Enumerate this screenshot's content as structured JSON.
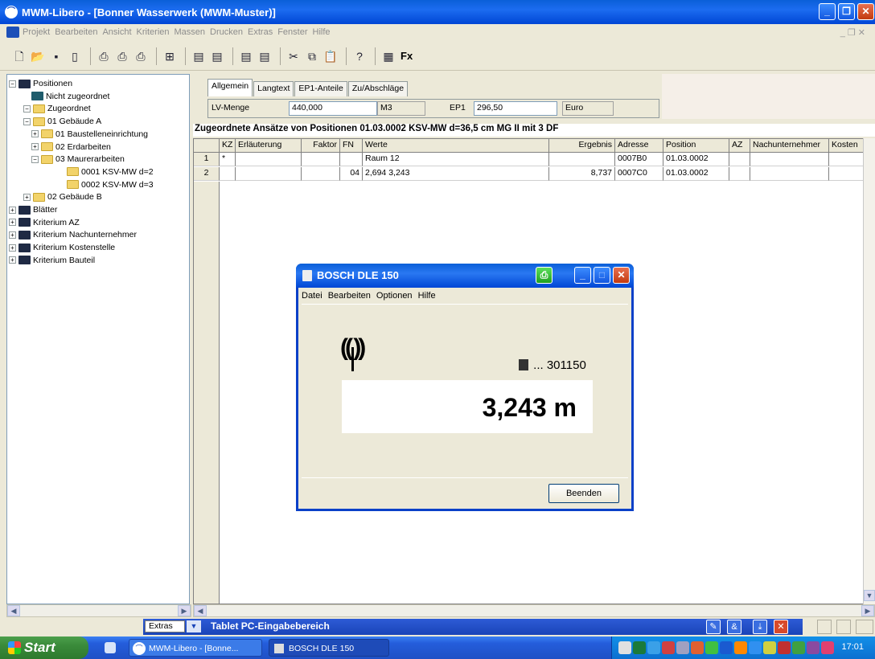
{
  "window": {
    "title": "MWM-Libero - [Bonner Wasserwerk (MWM-Muster)]"
  },
  "menu": [
    "Projekt",
    "Bearbeiten",
    "Ansicht",
    "Kriterien",
    "Massen",
    "Drucken",
    "Extras",
    "Fenster",
    "Hilfe"
  ],
  "toolbar": {
    "icons": [
      "new-icon",
      "open-icon",
      "save-icon",
      "properties-icon",
      "print-icon",
      "print-preview-icon",
      "print-setup-icon",
      "table-icon",
      "import-icon",
      "export-icon",
      "measure-in-icon",
      "measure-out-icon",
      "cut-icon",
      "copy-icon",
      "paste-icon",
      "help-icon",
      "calculator-icon"
    ],
    "fx_label": "Fx"
  },
  "tree": {
    "nodes": [
      {
        "label": "Positionen",
        "level": 0,
        "toggle": "−",
        "folder": "dark"
      },
      {
        "label": "Nicht zugeordnet",
        "level": 1,
        "toggle": "",
        "folder": "teal"
      },
      {
        "label": "Zugeordnet",
        "level": 1,
        "toggle": "−",
        "folder": "y"
      },
      {
        "label": "01 Gebäude A",
        "level": 2,
        "toggle": "−",
        "folder": "y"
      },
      {
        "label": "01 Baustelleneinrichtung",
        "level": 3,
        "toggle": "+",
        "folder": "y"
      },
      {
        "label": "02 Erdarbeiten",
        "level": 3,
        "toggle": "+",
        "folder": "y"
      },
      {
        "label": "03 Maurerarbeiten",
        "level": 3,
        "toggle": "−",
        "folder": "y"
      },
      {
        "label": "0001  KSV-MW d=2",
        "level": 4,
        "toggle": "",
        "folder": "y"
      },
      {
        "label": "0002  KSV-MW d=3",
        "level": 4,
        "toggle": "",
        "folder": "y"
      },
      {
        "label": "02 Gebäude B",
        "level": 2,
        "toggle": "+",
        "folder": "y"
      },
      {
        "label": "Blätter",
        "level": 0,
        "toggle": "+",
        "folder": "dark"
      },
      {
        "label": "Kriterium AZ",
        "level": 0,
        "toggle": "+",
        "folder": "dark"
      },
      {
        "label": "Kriterium Nachunternehmer",
        "level": 0,
        "toggle": "+",
        "folder": "dark"
      },
      {
        "label": "Kriterium Kostenstelle",
        "level": 0,
        "toggle": "+",
        "folder": "dark"
      },
      {
        "label": "Kriterium Bauteil",
        "level": 0,
        "toggle": "+",
        "folder": "dark"
      }
    ]
  },
  "tabs": [
    "Allgemein",
    "Langtext",
    "EP1-Anteile",
    "Zu/Abschläge"
  ],
  "fields": {
    "lv_menge_label": "LV-Menge",
    "lv_menge_value": "440,000",
    "unit": "M3",
    "ep1_label": "EP1",
    "ep1_value": "296,50",
    "currency": "Euro"
  },
  "grid": {
    "title": "Zugeordnete Ansätze von Positionen 01.03.0002  KSV-MW d=36,5 cm MG II mit 3 DF",
    "columns": [
      "KZ",
      "Erläuterung",
      "Faktor",
      "FN",
      "Werte",
      "Ergebnis",
      "Adresse",
      "Position",
      "AZ",
      "Nachunternehmer",
      "Kosten"
    ],
    "rows": [
      {
        "num": "1",
        "kz": "*",
        "erlaeuterung": "",
        "faktor": "",
        "fn": "",
        "werte": "Raum 12",
        "ergebnis": "",
        "adresse": "0007B0",
        "position": "01.03.0002",
        "az": "",
        "nachunternehmer": "",
        "kosten": ""
      },
      {
        "num": "2",
        "kz": "",
        "erlaeuterung": "",
        "faktor": "",
        "fn": "04",
        "werte": "2,694 3,243",
        "ergebnis": "8,737",
        "adresse": "0007C0",
        "position": "01.03.0002",
        "az": "",
        "nachunternehmer": "",
        "kosten": ""
      }
    ]
  },
  "dialog": {
    "title": "BOSCH DLE 150",
    "menu": [
      "Datei",
      "Bearbeiten",
      "Optionen",
      "Hilfe"
    ],
    "serial": "... 301150",
    "reading": "3,243 m",
    "close_button": "Beenden"
  },
  "tablet": {
    "extras": "Extras",
    "title": "Tablet PC-Eingabebereich"
  },
  "taskbar": {
    "start": "Start",
    "buttons": [
      "MWM-Libero - [Bonne...",
      "BOSCH DLE 150"
    ],
    "clock": "17:01"
  },
  "colors": {
    "xp_blue": "#0a5fd8",
    "close_red": "#c23a10",
    "start_green": "#3a8a3a"
  }
}
